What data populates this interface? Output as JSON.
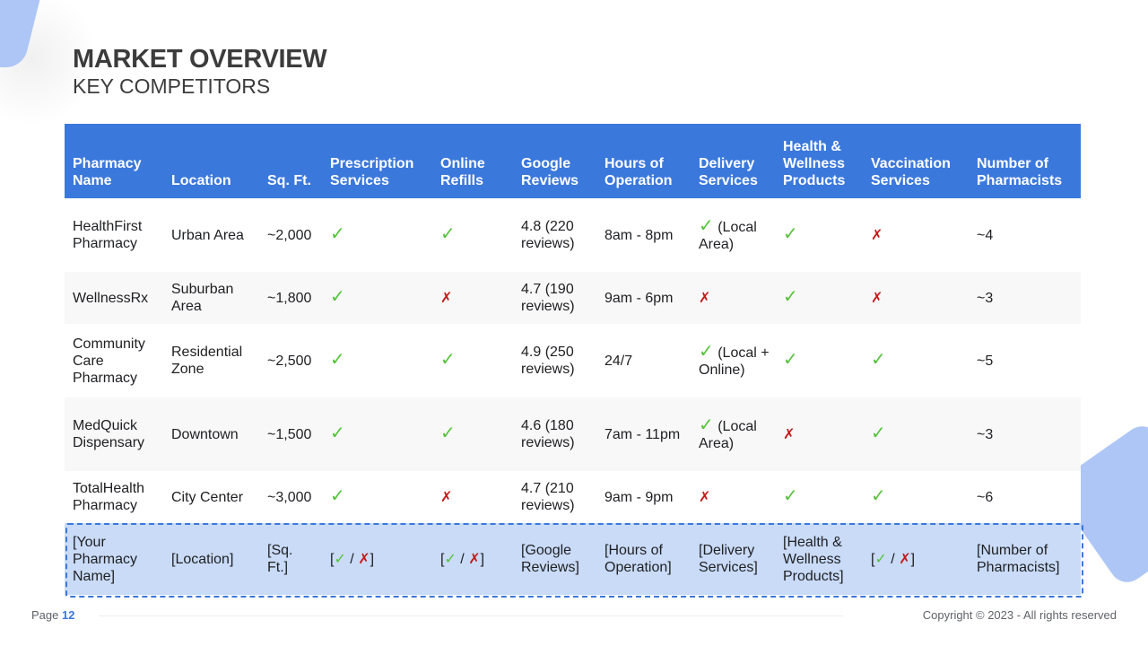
{
  "header": {
    "title": "MARKET OVERVIEW",
    "subtitle": "KEY COMPETITORS"
  },
  "table": {
    "columns": [
      "Pharmacy Name",
      "Location",
      "Sq. Ft.",
      "Prescription Services",
      "Online Refills",
      "Google Reviews",
      "Hours of Operation",
      "Delivery Services",
      "Health & Wellness Products",
      "Vaccination Services",
      "Number of Pharmacists"
    ],
    "rows": [
      {
        "name": "HealthFirst Pharmacy",
        "location": "Urban Area",
        "sqft": "~2,000",
        "prescription": "✓",
        "online_refills": "✓",
        "google_reviews": "4.8 (220 reviews)",
        "hours": "8am - 8pm",
        "delivery_mark": "✓",
        "delivery_note": "(Local Area)",
        "wellness": "✓",
        "vaccination": "✗",
        "pharmacists": "~4"
      },
      {
        "name": "WellnessRx",
        "location": "Suburban Area",
        "sqft": "~1,800",
        "prescription": "✓",
        "online_refills": "✗",
        "google_reviews": "4.7 (190 reviews)",
        "hours": "9am - 6pm",
        "delivery_mark": "✗",
        "delivery_note": "",
        "wellness": "✓",
        "vaccination": "✗",
        "pharmacists": "~3"
      },
      {
        "name": "Community Care Pharmacy",
        "location": "Residential Zone",
        "sqft": "~2,500",
        "prescription": "✓",
        "online_refills": "✓",
        "google_reviews": "4.9 (250 reviews)",
        "hours": "24/7",
        "delivery_mark": "✓",
        "delivery_note": "(Local + Online)",
        "wellness": "✓",
        "vaccination": "✓",
        "pharmacists": "~5"
      },
      {
        "name": "MedQuick Dispensary",
        "location": "Downtown",
        "sqft": "~1,500",
        "prescription": "✓",
        "online_refills": "✓",
        "google_reviews": "4.6 (180 reviews)",
        "hours": "7am - 11pm",
        "delivery_mark": "✓",
        "delivery_note": "(Local Area)",
        "wellness": "✗",
        "vaccination": "✓",
        "pharmacists": "~3"
      },
      {
        "name": "TotalHealth Pharmacy",
        "location": "City Center",
        "sqft": "~3,000",
        "prescription": "✓",
        "online_refills": "✗",
        "google_reviews": "4.7 (210 reviews)",
        "hours": "9am - 9pm",
        "delivery_mark": "✗",
        "delivery_note": "",
        "wellness": "✓",
        "vaccination": "✓",
        "pharmacists": "~6"
      }
    ],
    "placeholder_row": {
      "name": "[Your Pharmacy Name]",
      "location": "[Location]",
      "sqft": "[Sq. Ft.]",
      "bracket_open": "[",
      "check": "✓",
      "slash": " / ",
      "cross": "✗",
      "bracket_close": "]",
      "google_reviews": "[Google Reviews]",
      "hours": "[Hours of Operation]",
      "delivery": "[Delivery Services]",
      "wellness": "[Health & Wellness Products]",
      "pharmacists": "[Number of Pharmacists]"
    }
  },
  "footer": {
    "page_label": "Page",
    "page_number": "12",
    "copyright": "Copyright © 2023 - All rights reserved"
  },
  "colors": {
    "header_bg": "#3b78dc",
    "highlight_bg": "#c9dbf7",
    "check": "#55c23a",
    "cross": "#c41a1a",
    "accent_shape": "#aec6f6"
  }
}
